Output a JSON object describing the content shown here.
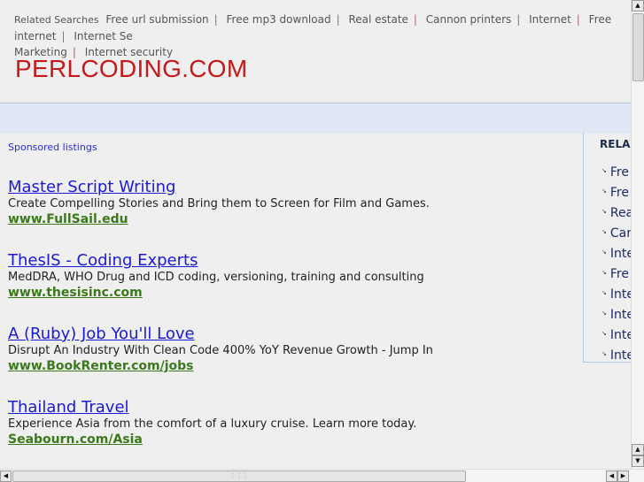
{
  "related_searches": {
    "label": "Related Searches",
    "items": [
      "Free url submission",
      "Free mp3 download",
      "Real estate",
      "Cannon printers",
      "Internet",
      "Free internet",
      "Internet Se",
      "Marketing",
      "Internet security"
    ]
  },
  "site_title": "PERLCODING.COM",
  "sponsored_label": "Sponsored listings",
  "ads": [
    {
      "title": "Master Script Writing",
      "desc": "Create Compelling Stories and Bring them to Screen for Film and Games.",
      "url": "www.FullSail.edu"
    },
    {
      "title": "ThesIS - Coding Experts",
      "desc": "MedDRA, WHO Drug and ICD coding, versioning, training and consulting",
      "url": "www.thesisinc.com"
    },
    {
      "title": "A (Ruby) Job You'll Love",
      "desc": "Disrupt An Industry With Clean Code 400% YoY Revenue Growth - Jump In",
      "url": "www.BookRenter.com/jobs"
    },
    {
      "title": "Thailand Travel",
      "desc": "Experience Asia from the comfort of a luxury cruise. Learn more today.",
      "url": "Seabourn.com/Asia"
    }
  ],
  "sidebar": {
    "heading": "RELA",
    "items": [
      "Fre",
      "Fre",
      "Rea",
      "Car",
      "Inte",
      "Fre",
      "Inte",
      "Inte",
      "Inte",
      "Inte"
    ]
  },
  "colors": {
    "title": "#c41a1a",
    "link": "#1a1ad8",
    "url": "#3a7a1a",
    "band": "#e1e7f4"
  }
}
